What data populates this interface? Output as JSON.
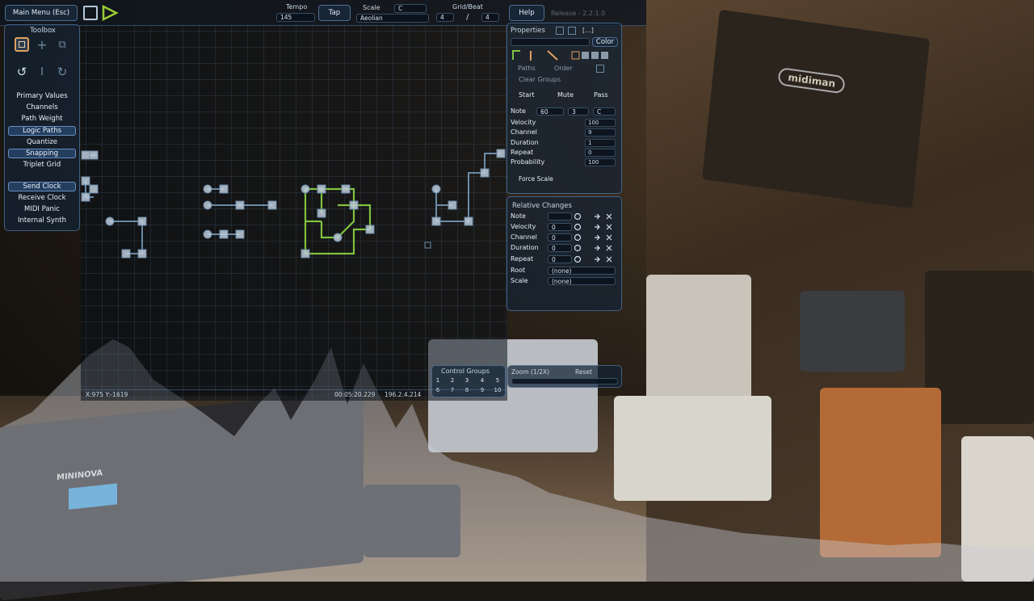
{
  "header": {
    "main_menu": "Main Menu (Esc)",
    "tempo_label": "Tempo",
    "tempo_value": "145",
    "tap": "Tap",
    "scale_label": "Scale",
    "scale_root": "C",
    "scale_mode": "Aeolian",
    "grid_beat_label": "Grid/Beat",
    "grid_num": "4",
    "grid_sep": "/",
    "grid_den": "4",
    "help": "Help",
    "release": "Release - 2.2.1.0"
  },
  "toolbox": {
    "title": "Toolbox",
    "items": [
      "Primary Values",
      "Channels",
      "Path Weight",
      "Logic Paths",
      "Quantize",
      "Snapping",
      "Triplet Grid"
    ],
    "active": [
      "Logic Paths",
      "Snapping"
    ],
    "clock_items": [
      "Send Clock",
      "Receive Clock",
      "MIDI Panic",
      "Internal Synth"
    ]
  },
  "properties": {
    "title": "Properties",
    "ellipsis": "[...]",
    "color": "Color",
    "paths": "Paths",
    "order": "Order",
    "clear_groups": "Clear Groups",
    "start": "Start",
    "mute": "Mute",
    "pass": "Pass",
    "note_label": "Note",
    "note_value": "60",
    "note_octave": "3",
    "note_name": "C",
    "rows": [
      {
        "label": "Velocity",
        "value": "100"
      },
      {
        "label": "Channel",
        "value": "9"
      },
      {
        "label": "Duration",
        "value": "1"
      },
      {
        "label": "Repeat",
        "value": "0"
      },
      {
        "label": "Probability",
        "value": "100"
      }
    ],
    "force_scale": "Force Scale"
  },
  "relative": {
    "title": "Relative Changes",
    "rows": [
      {
        "label": "Note",
        "value": ""
      },
      {
        "label": "Velocity",
        "value": "0"
      },
      {
        "label": "Channel",
        "value": "0"
      },
      {
        "label": "Duration",
        "value": "0"
      },
      {
        "label": "Repeat",
        "value": "0"
      }
    ],
    "root_label": "Root",
    "root_value": "(none)",
    "scale_label": "Scale",
    "scale_value": "(none)"
  },
  "control_groups": {
    "title": "Control Groups",
    "row1": [
      "1",
      "2",
      "3",
      "4",
      "5"
    ],
    "row2": [
      "6",
      "7",
      "8",
      "9",
      "10"
    ]
  },
  "zoom": {
    "label": "Zoom (1/2X)",
    "reset": "Reset"
  },
  "status": {
    "coords": "X:975 Y:-1619",
    "time": "00:05:20.229",
    "ip": "196.2.4.214"
  },
  "hardware": {
    "brand1": "midiman",
    "brand2": "MININOVA"
  },
  "colors": {
    "accent": "#7fc241",
    "play": "#9acd32",
    "panel_border": "#6496c8"
  }
}
